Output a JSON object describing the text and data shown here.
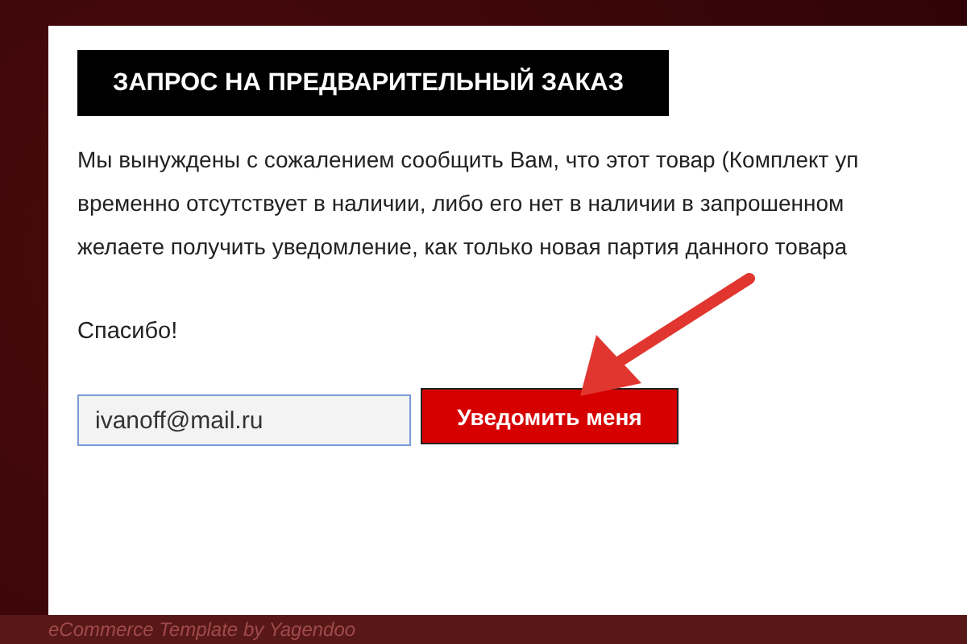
{
  "heading": "ЗАПРОС НА ПРЕДВАРИТЕЛЬНЫЙ ЗАКАЗ",
  "message_lines": [
    "Мы вынуждены с сожалением сообщить Вам, что этот товар (Комплект уп",
    "временно отсутствует в наличии, либо его нет в наличии в запрошенном",
    "желаете получить уведомление, как только новая партия данного товара"
  ],
  "thanks": "Спасибо!",
  "email_field": {
    "value": "ivanoff@mail.ru"
  },
  "notify_button": "Уведомить меня",
  "footer": "eCommerce Template by Yagendoo"
}
